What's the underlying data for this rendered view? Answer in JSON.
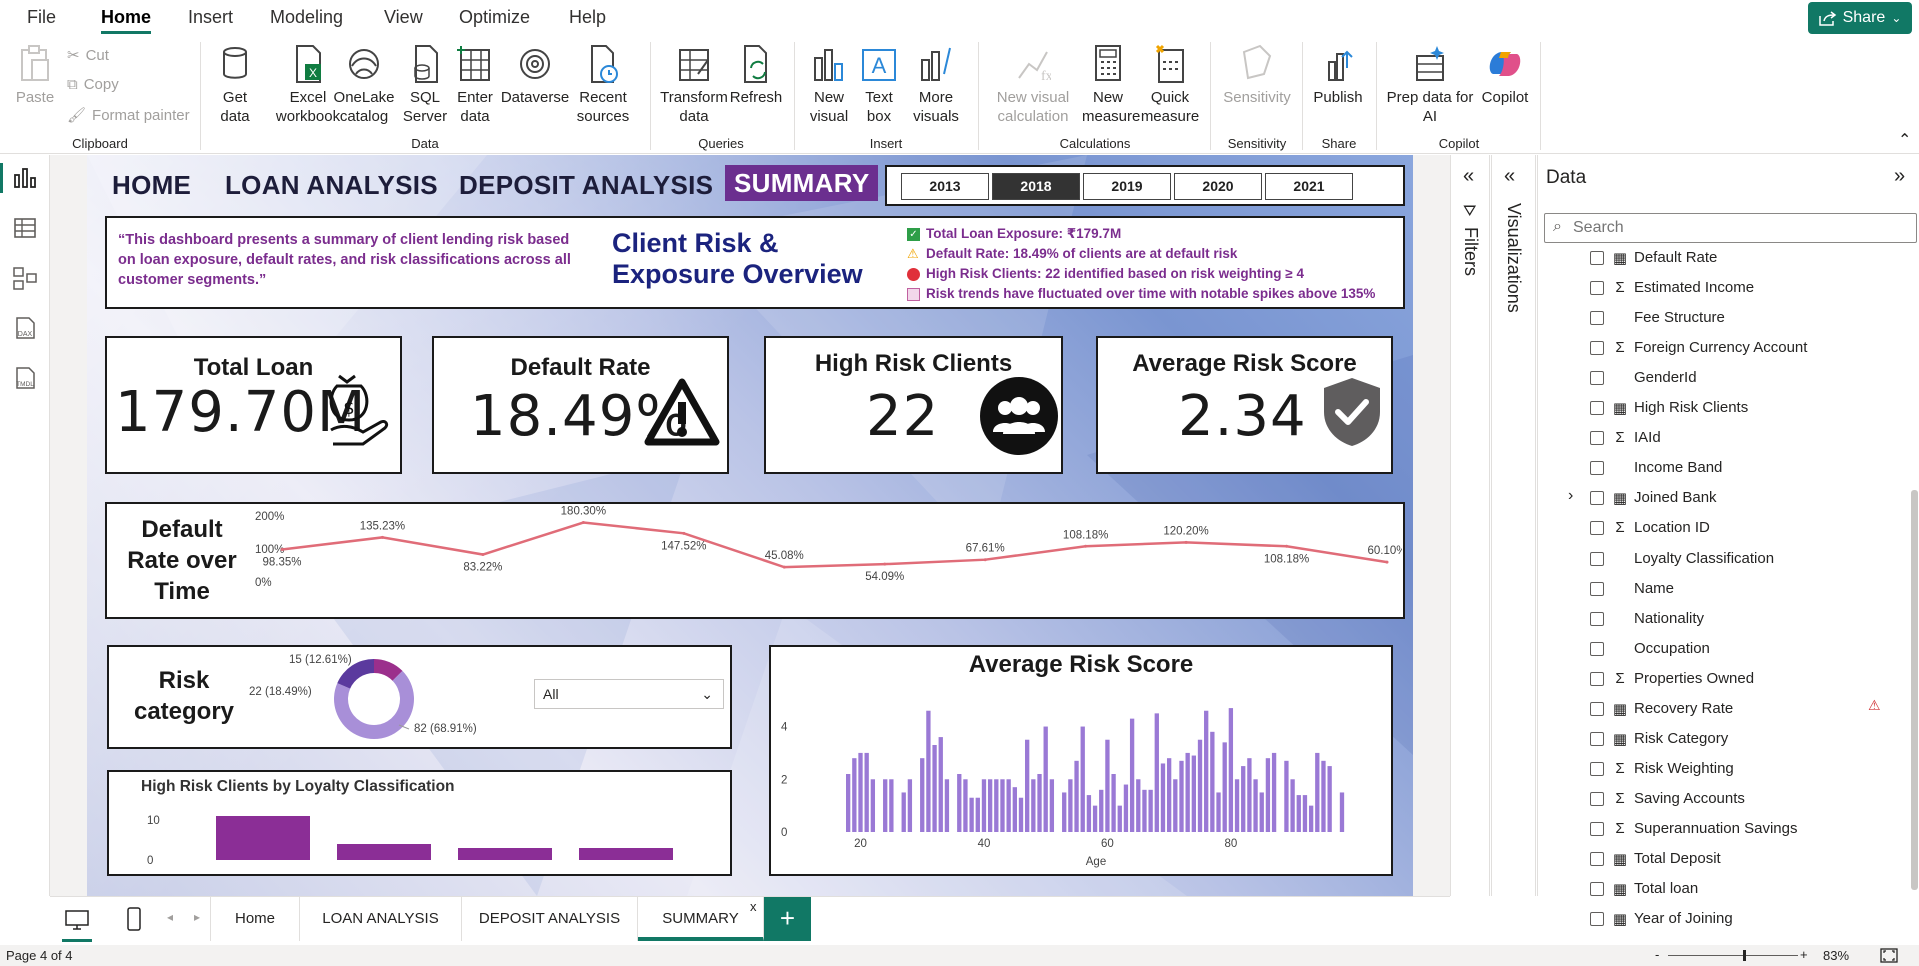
{
  "menu": {
    "items": [
      "File",
      "Home",
      "Insert",
      "Modeling",
      "View",
      "Optimize",
      "Help"
    ],
    "active": "Home",
    "share_label": "Share"
  },
  "ribbon": {
    "clipboard": {
      "paste": "Paste",
      "cut": "Cut",
      "copy": "Copy",
      "format_painter": "Format painter",
      "group": "Clipboard"
    },
    "data": {
      "get_data": "Get data",
      "excel": "Excel workbook",
      "onelake": "OneLake catalog",
      "sql": "SQL Server",
      "enter": "Enter data",
      "dataverse": "Dataverse",
      "recent": "Recent sources",
      "group": "Data"
    },
    "queries": {
      "transform": "Transform data",
      "refresh": "Refresh",
      "group": "Queries"
    },
    "insert": {
      "new_visual": "New visual",
      "text_box": "Text box",
      "more_visuals": "More visuals",
      "group": "Insert"
    },
    "calculations": {
      "new_visual_calc": "New visual calculation",
      "new_measure": "New measure",
      "quick_measure": "Quick measure",
      "group": "Calculations"
    },
    "sensitivity": {
      "label": "Sensitivity",
      "group": "Sensitivity"
    },
    "share": {
      "publish": "Publish",
      "group": "Share"
    },
    "copilot": {
      "prep": "Prep data for AI",
      "copilot": "Copilot",
      "group": "Copilot"
    }
  },
  "report": {
    "nav": [
      "HOME",
      "LOAN ANALYSIS",
      "DEPOSIT ANALYSIS",
      "SUMMARY"
    ],
    "years": [
      "2013",
      "2018",
      "2019",
      "2020",
      "2021"
    ],
    "selected_year": "2018",
    "summary_text": "“This dashboard presents a summary of client lending risk based on loan exposure, default rates, and risk classifications across all customer segments.”",
    "title": "Client Risk & Exposure Overview",
    "bullets": [
      {
        "icon": "check-icon",
        "color": "#2e9e48",
        "text": "Total Loan Exposure: ₹179.7M"
      },
      {
        "icon": "warning-icon",
        "color": "#f0a400",
        "text": "Default Rate: 18.49% of clients are at default risk"
      },
      {
        "icon": "red-dot-icon",
        "color": "#e0303a",
        "text": "High Risk Clients: 22 identified based on risk weighting ≥ 4"
      },
      {
        "icon": "trend-down-icon",
        "color": "#c060a0",
        "text": "Risk trends have fluctuated over time with notable spikes above 135%"
      }
    ],
    "kpis": {
      "total_loan": {
        "title": "Total Loan",
        "value": "179.70M"
      },
      "default_rate": {
        "title": "Default Rate",
        "value": "18.49%"
      },
      "high_risk": {
        "title": "High Risk Clients",
        "value": "22"
      },
      "avg_risk": {
        "title": "Average Risk Score",
        "value": "2.34"
      }
    },
    "default_rate_title": "Default Rate over Time",
    "risk_category_title": "Risk category",
    "dropdown_value": "All",
    "loyalty_title": "High Risk Clients by Loyalty Classification",
    "avg_risk_title": "Average Risk Score"
  },
  "chart_data": [
    {
      "type": "line",
      "title": "Default Rate over Time",
      "ylim": [
        0,
        200
      ],
      "yticks": [
        "200%",
        "100%",
        "0%"
      ],
      "values": [
        98.35,
        135.23,
        83.22,
        180.3,
        147.52,
        45.08,
        54.09,
        67.61,
        108.18,
        120.2,
        108.18,
        60.1
      ],
      "labels": [
        "98.35%",
        "135.23%",
        "83.22%",
        "180.30%",
        "147.52%",
        "45.08%",
        "54.09%",
        "67.61%",
        "108.18%",
        "120.20%",
        "108.18%",
        "60.10%"
      ],
      "color": "#e06c78"
    },
    {
      "type": "pie",
      "title": "Risk category",
      "slices": [
        {
          "value": 82,
          "label": "82 (68.91%)",
          "color": "#a88fd8"
        },
        {
          "value": 22,
          "label": "22 (18.49%)",
          "color": "#5b3a9e"
        },
        {
          "value": 15,
          "label": "15 (12.61%)",
          "color": "#9b2f8c"
        }
      ]
    },
    {
      "type": "bar",
      "title": "High Risk Clients by Loyalty Classification",
      "ylim": [
        0,
        12
      ],
      "yticks": [
        "10",
        "0"
      ],
      "values": [
        11,
        4,
        3,
        3
      ],
      "color": "#8b2e96"
    },
    {
      "type": "bar",
      "title": "Average Risk Score",
      "xlabel": "Age",
      "ylim": [
        0,
        5.5
      ],
      "yticks": [
        "4",
        "2",
        "0"
      ],
      "xticks": [
        "20",
        "40",
        "60",
        "80"
      ],
      "xticks_at": [
        20,
        40,
        60,
        80
      ],
      "x_start": 18,
      "values": [
        2.2,
        2.8,
        3.0,
        3.0,
        2.0,
        0,
        2.0,
        2.0,
        0,
        1.5,
        2.0,
        0,
        2.8,
        4.6,
        3.3,
        3.6,
        2.0,
        0,
        2.2,
        2.0,
        1.3,
        1.3,
        2.0,
        2.0,
        2.0,
        2.0,
        2.0,
        1.7,
        1.3,
        3.5,
        2.0,
        2.2,
        4.0,
        2.0,
        0,
        1.5,
        2.0,
        2.7,
        4.0,
        1.4,
        1.0,
        1.6,
        3.5,
        2.2,
        1.0,
        1.8,
        4.3,
        2.0,
        1.6,
        1.6,
        4.5,
        2.6,
        2.8,
        2.0,
        2.7,
        3.0,
        2.9,
        3.5,
        4.6,
        3.8,
        1.5,
        3.4,
        4.7,
        2.0,
        2.5,
        2.8,
        2.0,
        1.5,
        2.8,
        3.0,
        0,
        2.7,
        2.0,
        1.4,
        1.4,
        1.0,
        3.0,
        2.7,
        2.5,
        0,
        1.5
      ],
      "color": "#9a79d5"
    }
  ],
  "filters_label": "Filters",
  "visualizations_label": "Visualizations",
  "data_pane": {
    "title": "Data",
    "search_placeholder": "Search",
    "fields": [
      {
        "icon": "calculator-icon",
        "glyph": "▦",
        "name": "Default Rate"
      },
      {
        "icon": "sigma-icon",
        "glyph": "Σ",
        "name": "Estimated Income"
      },
      {
        "icon": "none",
        "glyph": "",
        "name": "Fee Structure"
      },
      {
        "icon": "sigma-icon",
        "glyph": "Σ",
        "name": "Foreign Currency Account"
      },
      {
        "icon": "none",
        "glyph": "",
        "name": "GenderId"
      },
      {
        "icon": "calculator-icon",
        "glyph": "▦",
        "name": "High Risk Clients"
      },
      {
        "icon": "sigma-icon",
        "glyph": "Σ",
        "name": "IAId"
      },
      {
        "icon": "none",
        "glyph": "",
        "name": "Income Band"
      },
      {
        "icon": "calendar-icon",
        "glyph": "▦",
        "name": "Joined Bank"
      },
      {
        "icon": "sigma-icon",
        "glyph": "Σ",
        "name": "Location ID"
      },
      {
        "icon": "none",
        "glyph": "",
        "name": "Loyalty Classification"
      },
      {
        "icon": "none",
        "glyph": "",
        "name": "Name"
      },
      {
        "icon": "none",
        "glyph": "",
        "name": "Nationality"
      },
      {
        "icon": "none",
        "glyph": "",
        "name": "Occupation"
      },
      {
        "icon": "sigma-icon",
        "glyph": "Σ",
        "name": "Properties Owned"
      },
      {
        "icon": "calculator-icon",
        "glyph": "▦",
        "name": "Recovery Rate"
      },
      {
        "icon": "calc-column-icon",
        "glyph": "▦",
        "name": "Risk Category"
      },
      {
        "icon": "sigma-icon",
        "glyph": "Σ",
        "name": "Risk Weighting"
      },
      {
        "icon": "sigma-icon",
        "glyph": "Σ",
        "name": "Saving Accounts"
      },
      {
        "icon": "sigma-icon",
        "glyph": "Σ",
        "name": "Superannuation Savings"
      },
      {
        "icon": "calculator-icon",
        "glyph": "▦",
        "name": "Total Deposit"
      },
      {
        "icon": "calculator-icon",
        "glyph": "▦",
        "name": "Total loan"
      },
      {
        "icon": "calc-column-icon",
        "glyph": "▦",
        "name": "Year of Joining"
      }
    ]
  },
  "pages": {
    "tabs": [
      "Home",
      "LOAN ANALYSIS",
      "DEPOSIT ANALYSIS",
      "SUMMARY"
    ],
    "active": "SUMMARY",
    "close_glyph": "x",
    "add_glyph": "+"
  },
  "status": {
    "page": "Page 4 of 4",
    "zoom": "83%",
    "minus": "-",
    "plus": "+"
  }
}
